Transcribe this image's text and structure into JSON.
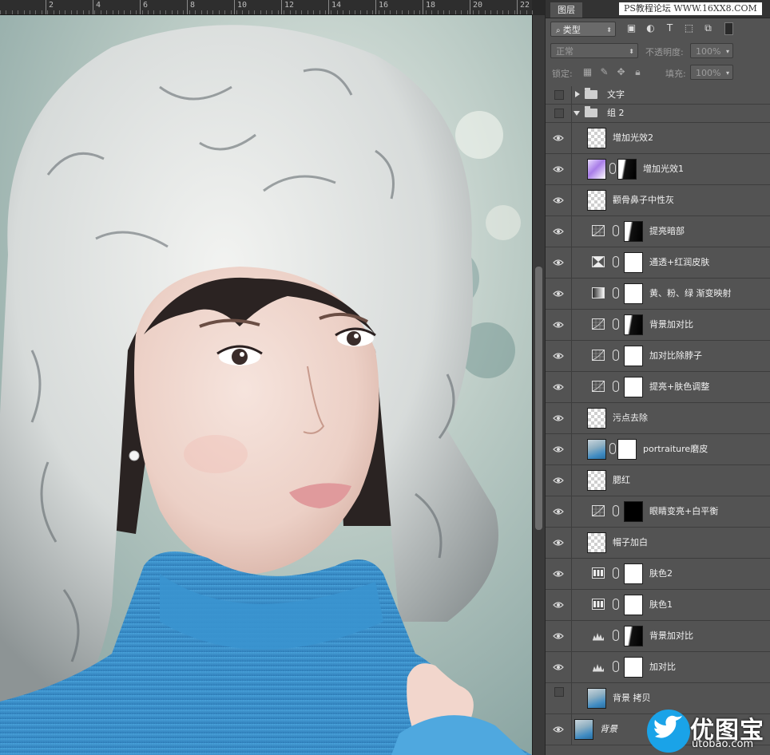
{
  "ruler": {
    "ticks": [
      "2",
      "4",
      "6",
      "8",
      "10",
      "12",
      "14",
      "16",
      "18",
      "20",
      "22"
    ]
  },
  "panel": {
    "tab_label": "图层",
    "watermark": "PS教程论坛 WWW.16XX8.COM",
    "filter_kind": "类型",
    "blend_mode": "正常",
    "opacity_label": "不透明度:",
    "opacity_value": "100%",
    "lock_label": "锁定:",
    "fill_label": "填充:",
    "fill_value": "100%"
  },
  "layers": [
    {
      "name": "文字",
      "kind": "group",
      "expanded": false,
      "visible": false
    },
    {
      "name": "组 2",
      "kind": "group",
      "expanded": true,
      "visible": false
    },
    {
      "name": "增加光效2",
      "kind": "pixel",
      "visible": true
    },
    {
      "name": "增加光效1",
      "kind": "pixel-mask",
      "visible": true
    },
    {
      "name": "颧骨鼻子中性灰",
      "kind": "pixel",
      "visible": true
    },
    {
      "name": "提亮暗部",
      "kind": "curves",
      "visible": true,
      "mask": "dark"
    },
    {
      "name": "通透+红润皮肤",
      "kind": "channel-mixer",
      "visible": true,
      "mask": "white"
    },
    {
      "name": "黄、粉、绿 渐变映射",
      "kind": "gradient-map",
      "visible": true,
      "mask": "white"
    },
    {
      "name": "背景加对比",
      "kind": "curves",
      "visible": true,
      "mask": "dark"
    },
    {
      "name": "加对比除脖子",
      "kind": "curves",
      "visible": true,
      "mask": "white"
    },
    {
      "name": "提亮+肤色调整",
      "kind": "curves",
      "visible": true,
      "mask": "white"
    },
    {
      "name": "污点去除",
      "kind": "pixel",
      "visible": true
    },
    {
      "name": "portraiture磨皮",
      "kind": "photo-mask",
      "visible": true
    },
    {
      "name": "腮红",
      "kind": "pixel",
      "visible": true
    },
    {
      "name": "眼睛变亮+白平衡",
      "kind": "curves",
      "visible": true,
      "mask": "black"
    },
    {
      "name": "帽子加白",
      "kind": "pixel",
      "visible": true
    },
    {
      "name": "肤色2",
      "kind": "color-balance",
      "visible": true,
      "mask": "white"
    },
    {
      "name": "肤色1",
      "kind": "color-balance",
      "visible": true,
      "mask": "white"
    },
    {
      "name": "背景加对比",
      "kind": "levels",
      "visible": true,
      "mask": "dark"
    },
    {
      "name": "加对比",
      "kind": "levels",
      "visible": true,
      "mask": "white"
    },
    {
      "name": "背景 拷贝",
      "kind": "photo",
      "visible": false
    },
    {
      "name": "背景",
      "kind": "photo",
      "visible": true,
      "italic": true
    }
  ],
  "logo": {
    "cn": "优图宝",
    "en": "utobao.com",
    "color": "#1aa3e8"
  },
  "colors": {
    "panel": "#535353",
    "accent": "#1aa3e8"
  }
}
